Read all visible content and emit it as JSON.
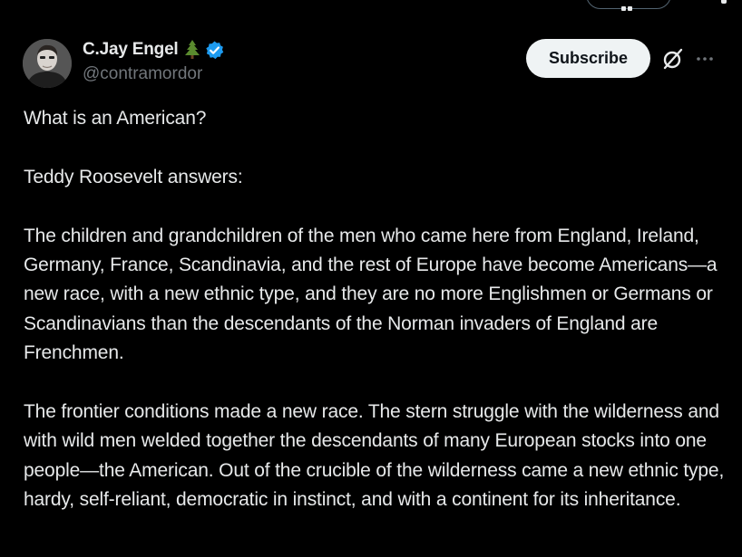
{
  "author": {
    "display_name": "C.Jay Engel",
    "name_emoji": "christmas-tree",
    "verified": true,
    "handle": "@contramordor"
  },
  "actions": {
    "subscribe_label": "Subscribe",
    "grok_icon": "grok-icon",
    "more_icon": "more-options-icon"
  },
  "colors": {
    "background": "#000000",
    "text": "#e7e9ea",
    "secondary_text": "#71767b",
    "verified_badge": "#1d9bf0",
    "button_bg": "#eff3f4",
    "button_text": "#0f1419"
  },
  "post": {
    "paragraphs": [
      "What is an American?",
      "Teddy Roosevelt answers:",
      "The children and grandchildren of the men who came here from England, Ireland, Germany, France, Scandinavia, and the rest of Europe have become Americans—a new race, with a new ethnic type, and they are no more Englishmen or Germans or Scandinavians than the descendants of the Norman invaders of England are Frenchmen.",
      "The frontier conditions made a new race. The stern struggle with the wilderness and with wild men welded together the descendants of many European stocks into one people—the American. Out of the crucible of the wilderness came a new ethnic type, hardy, self-reliant, democratic in instinct, and with a continent for its inheritance."
    ]
  }
}
